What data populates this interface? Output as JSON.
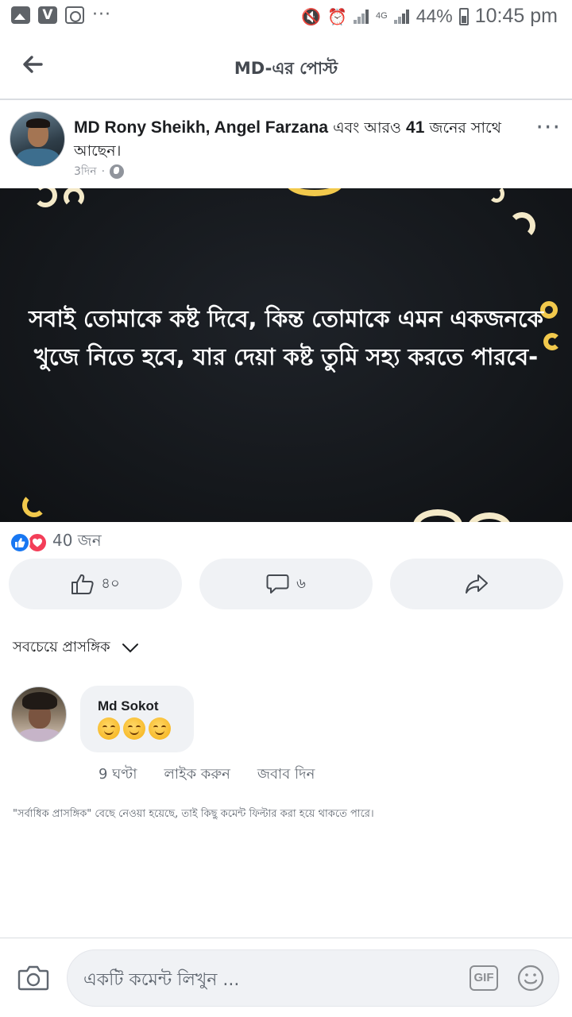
{
  "status_bar": {
    "battery": "44%",
    "time": "10:45 pm",
    "network": "4G"
  },
  "header": {
    "title": "MD-এর পোস্ট"
  },
  "post": {
    "author_names": "MD Rony Sheikh, Angel Farzana",
    "with_text_mid": " এবং আরও ",
    "with_count": "41",
    "with_text_end": " জনের সাথে আছেন।",
    "time": "3দিন",
    "image_text": "সবাই তোমাকে কষ্ট দিবে, কিন্ত তোমাকে এমন একজনকে খুজে নিতে হবে, যার দেয়া কষ্ট তুমি সহ্য করতে পারবে-",
    "reactions_count": "40 জন",
    "like_count": "৪০",
    "comment_count": "৬"
  },
  "comments_section": {
    "sort_label": "সবচেয়ে প্রাসঙ্গিক",
    "filter_note": "\"সর্বাধিক প্রাসঙ্গিক\" বেছে নেওয়া হয়েছে, তাই কিছু কমেন্ট ফিল্টার করা হয়ে থাকতে পারে।"
  },
  "comment": {
    "author": "Md Sokot",
    "emoji_count": 3,
    "time": "9 ঘণ্টা",
    "like_label": "লাইক করুন",
    "reply_label": "জবাব দিন"
  },
  "composer": {
    "placeholder": "একটি কমেন্ট লিখুন ...",
    "gif_label": "GIF"
  },
  "colors": {
    "accent": "#1877f2",
    "love": "#f33e58",
    "bubble": "#f0f2f5",
    "image_bg": "#15181c"
  }
}
